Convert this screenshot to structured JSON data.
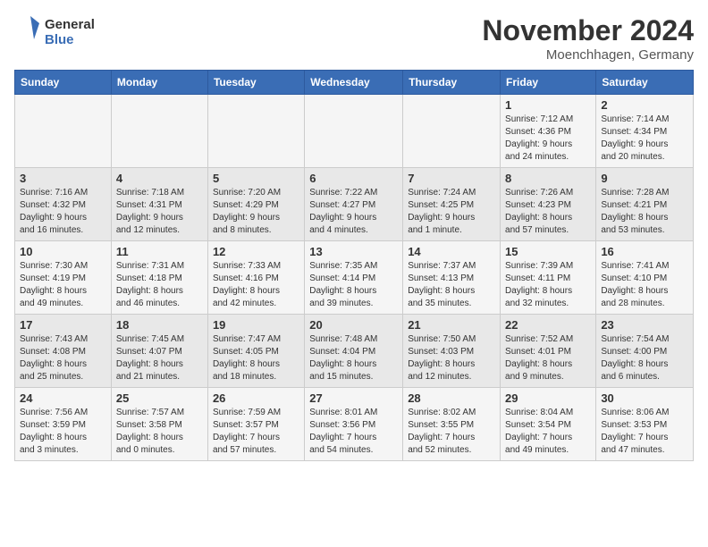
{
  "header": {
    "logo_general": "General",
    "logo_blue": "Blue",
    "month_title": "November 2024",
    "location": "Moenchhagen, Germany"
  },
  "weekdays": [
    "Sunday",
    "Monday",
    "Tuesday",
    "Wednesday",
    "Thursday",
    "Friday",
    "Saturday"
  ],
  "weeks": [
    [
      {
        "day": "",
        "info": ""
      },
      {
        "day": "",
        "info": ""
      },
      {
        "day": "",
        "info": ""
      },
      {
        "day": "",
        "info": ""
      },
      {
        "day": "",
        "info": ""
      },
      {
        "day": "1",
        "info": "Sunrise: 7:12 AM\nSunset: 4:36 PM\nDaylight: 9 hours\nand 24 minutes."
      },
      {
        "day": "2",
        "info": "Sunrise: 7:14 AM\nSunset: 4:34 PM\nDaylight: 9 hours\nand 20 minutes."
      }
    ],
    [
      {
        "day": "3",
        "info": "Sunrise: 7:16 AM\nSunset: 4:32 PM\nDaylight: 9 hours\nand 16 minutes."
      },
      {
        "day": "4",
        "info": "Sunrise: 7:18 AM\nSunset: 4:31 PM\nDaylight: 9 hours\nand 12 minutes."
      },
      {
        "day": "5",
        "info": "Sunrise: 7:20 AM\nSunset: 4:29 PM\nDaylight: 9 hours\nand 8 minutes."
      },
      {
        "day": "6",
        "info": "Sunrise: 7:22 AM\nSunset: 4:27 PM\nDaylight: 9 hours\nand 4 minutes."
      },
      {
        "day": "7",
        "info": "Sunrise: 7:24 AM\nSunset: 4:25 PM\nDaylight: 9 hours\nand 1 minute."
      },
      {
        "day": "8",
        "info": "Sunrise: 7:26 AM\nSunset: 4:23 PM\nDaylight: 8 hours\nand 57 minutes."
      },
      {
        "day": "9",
        "info": "Sunrise: 7:28 AM\nSunset: 4:21 PM\nDaylight: 8 hours\nand 53 minutes."
      }
    ],
    [
      {
        "day": "10",
        "info": "Sunrise: 7:30 AM\nSunset: 4:19 PM\nDaylight: 8 hours\nand 49 minutes."
      },
      {
        "day": "11",
        "info": "Sunrise: 7:31 AM\nSunset: 4:18 PM\nDaylight: 8 hours\nand 46 minutes."
      },
      {
        "day": "12",
        "info": "Sunrise: 7:33 AM\nSunset: 4:16 PM\nDaylight: 8 hours\nand 42 minutes."
      },
      {
        "day": "13",
        "info": "Sunrise: 7:35 AM\nSunset: 4:14 PM\nDaylight: 8 hours\nand 39 minutes."
      },
      {
        "day": "14",
        "info": "Sunrise: 7:37 AM\nSunset: 4:13 PM\nDaylight: 8 hours\nand 35 minutes."
      },
      {
        "day": "15",
        "info": "Sunrise: 7:39 AM\nSunset: 4:11 PM\nDaylight: 8 hours\nand 32 minutes."
      },
      {
        "day": "16",
        "info": "Sunrise: 7:41 AM\nSunset: 4:10 PM\nDaylight: 8 hours\nand 28 minutes."
      }
    ],
    [
      {
        "day": "17",
        "info": "Sunrise: 7:43 AM\nSunset: 4:08 PM\nDaylight: 8 hours\nand 25 minutes."
      },
      {
        "day": "18",
        "info": "Sunrise: 7:45 AM\nSunset: 4:07 PM\nDaylight: 8 hours\nand 21 minutes."
      },
      {
        "day": "19",
        "info": "Sunrise: 7:47 AM\nSunset: 4:05 PM\nDaylight: 8 hours\nand 18 minutes."
      },
      {
        "day": "20",
        "info": "Sunrise: 7:48 AM\nSunset: 4:04 PM\nDaylight: 8 hours\nand 15 minutes."
      },
      {
        "day": "21",
        "info": "Sunrise: 7:50 AM\nSunset: 4:03 PM\nDaylight: 8 hours\nand 12 minutes."
      },
      {
        "day": "22",
        "info": "Sunrise: 7:52 AM\nSunset: 4:01 PM\nDaylight: 8 hours\nand 9 minutes."
      },
      {
        "day": "23",
        "info": "Sunrise: 7:54 AM\nSunset: 4:00 PM\nDaylight: 8 hours\nand 6 minutes."
      }
    ],
    [
      {
        "day": "24",
        "info": "Sunrise: 7:56 AM\nSunset: 3:59 PM\nDaylight: 8 hours\nand 3 minutes."
      },
      {
        "day": "25",
        "info": "Sunrise: 7:57 AM\nSunset: 3:58 PM\nDaylight: 8 hours\nand 0 minutes."
      },
      {
        "day": "26",
        "info": "Sunrise: 7:59 AM\nSunset: 3:57 PM\nDaylight: 7 hours\nand 57 minutes."
      },
      {
        "day": "27",
        "info": "Sunrise: 8:01 AM\nSunset: 3:56 PM\nDaylight: 7 hours\nand 54 minutes."
      },
      {
        "day": "28",
        "info": "Sunrise: 8:02 AM\nSunset: 3:55 PM\nDaylight: 7 hours\nand 52 minutes."
      },
      {
        "day": "29",
        "info": "Sunrise: 8:04 AM\nSunset: 3:54 PM\nDaylight: 7 hours\nand 49 minutes."
      },
      {
        "day": "30",
        "info": "Sunrise: 8:06 AM\nSunset: 3:53 PM\nDaylight: 7 hours\nand 47 minutes."
      }
    ]
  ]
}
